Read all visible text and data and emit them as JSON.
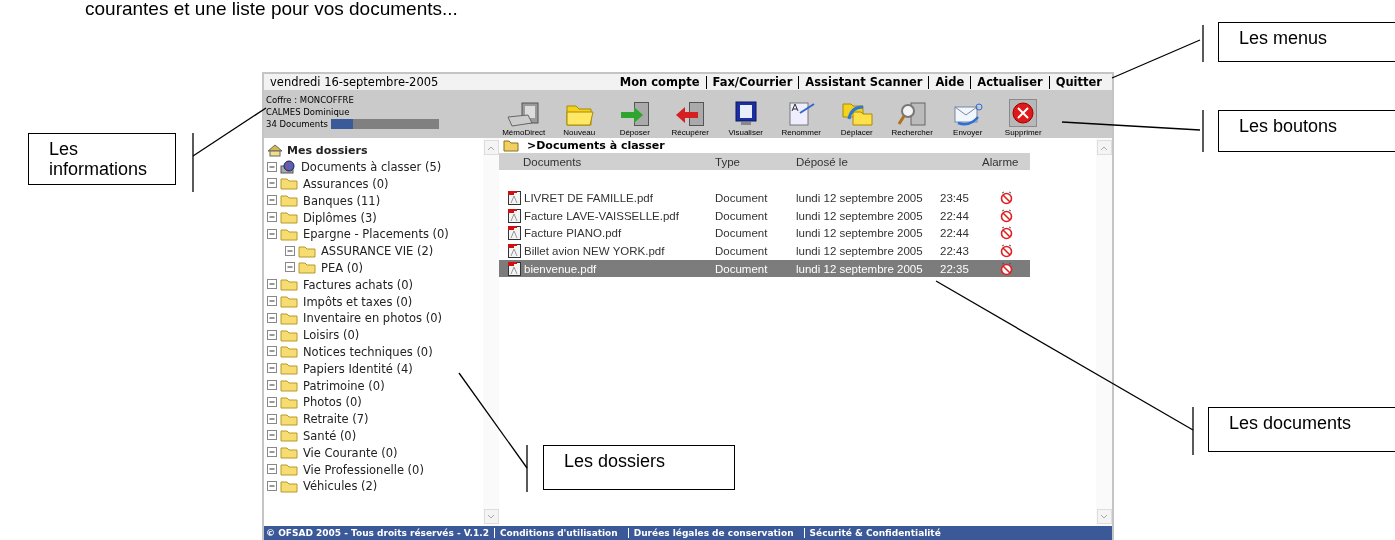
{
  "intro_text": "courantes et une liste pour vos documents...",
  "app": {
    "date": "vendredi 16-septembre-2005",
    "menus": [
      "Mon compte",
      "Fax/Courrier",
      "Assistant Scanner",
      "Aide",
      "Actualiser",
      "Quitter"
    ],
    "info": {
      "vault": "Coffre : MONCOFFRE",
      "user": "CALMES Dominique",
      "doc_count": "34 Documents",
      "storage": {
        "level": 0.2
      }
    },
    "toolbar": [
      "MémoDirect",
      "Nouveau",
      "Déposer",
      "Récupérer",
      "Visualiser",
      "Renommer",
      "Déplacer",
      "Rechercher",
      "Envoyer",
      "Supprimer"
    ],
    "tree": {
      "root": "Mes dossiers",
      "items": [
        {
          "label": "Documents à classer (5)",
          "kind": "inbox"
        },
        {
          "label": "Assurances (0)",
          "kind": "folder"
        },
        {
          "label": "Banques (11)",
          "kind": "folder"
        },
        {
          "label": "Diplômes (3)",
          "kind": "folder"
        },
        {
          "label": "Epargne - Placements (0)",
          "kind": "folder",
          "children": [
            {
              "label": "ASSURANCE VIE (2)",
              "kind": "folder"
            },
            {
              "label": "PEA (0)",
              "kind": "folder"
            }
          ]
        },
        {
          "label": "Factures achats (0)",
          "kind": "folder"
        },
        {
          "label": "Impôts et taxes (0)",
          "kind": "folder"
        },
        {
          "label": "Inventaire en photos (0)",
          "kind": "folder"
        },
        {
          "label": "Loisirs (0)",
          "kind": "folder"
        },
        {
          "label": "Notices techniques (0)",
          "kind": "folder"
        },
        {
          "label": "Papiers Identité (4)",
          "kind": "folder"
        },
        {
          "label": "Patrimoine (0)",
          "kind": "folder"
        },
        {
          "label": "Photos (0)",
          "kind": "folder"
        },
        {
          "label": "Retraite (7)",
          "kind": "folder"
        },
        {
          "label": "Santé (0)",
          "kind": "folder"
        },
        {
          "label": "Vie Courante (0)",
          "kind": "folder"
        },
        {
          "label": "Vie Professionelle (0)",
          "kind": "folder"
        },
        {
          "label": "Véhicules (2)",
          "kind": "folder"
        }
      ]
    },
    "path": ">Documents à classer",
    "table": {
      "columns": [
        "Documents",
        "Type",
        "Déposé le",
        "Alarme"
      ],
      "rows": [
        {
          "name": "LIVRET DE FAMILLE.pdf",
          "type": "Document",
          "date": "lundi 12 septembre 2005",
          "time": "23:45",
          "selected": false
        },
        {
          "name": "Facture LAVE-VAISSELLE.pdf",
          "type": "Document",
          "date": "lundi 12 septembre 2005",
          "time": "22:44",
          "selected": false
        },
        {
          "name": "Facture PIANO.pdf",
          "type": "Document",
          "date": "lundi 12 septembre 2005",
          "time": "22:44",
          "selected": false
        },
        {
          "name": "Billet avion NEW YORK.pdf",
          "type": "Document",
          "date": "lundi 12 septembre 2005",
          "time": "22:43",
          "selected": false
        },
        {
          "name": "bienvenue.pdf",
          "type": "Document",
          "date": "lundi 12 septembre 2005",
          "time": "22:35",
          "selected": true
        }
      ]
    },
    "footer": {
      "copyright": "© OFSAD 2005 - Tous droits réservés - V.1.2",
      "links": [
        "Conditions d'utilisation",
        "Durées légales de conservation",
        "Sécurité & Confidentialité"
      ]
    }
  },
  "callouts": [
    {
      "kind": "menus",
      "label": "Les menus"
    },
    {
      "kind": "buttons",
      "label": "Les boutons"
    },
    {
      "kind": "info",
      "label": "Les informations"
    },
    {
      "kind": "folders",
      "label": "Les dossiers"
    },
    {
      "kind": "documents",
      "label": "Les documents"
    }
  ]
}
